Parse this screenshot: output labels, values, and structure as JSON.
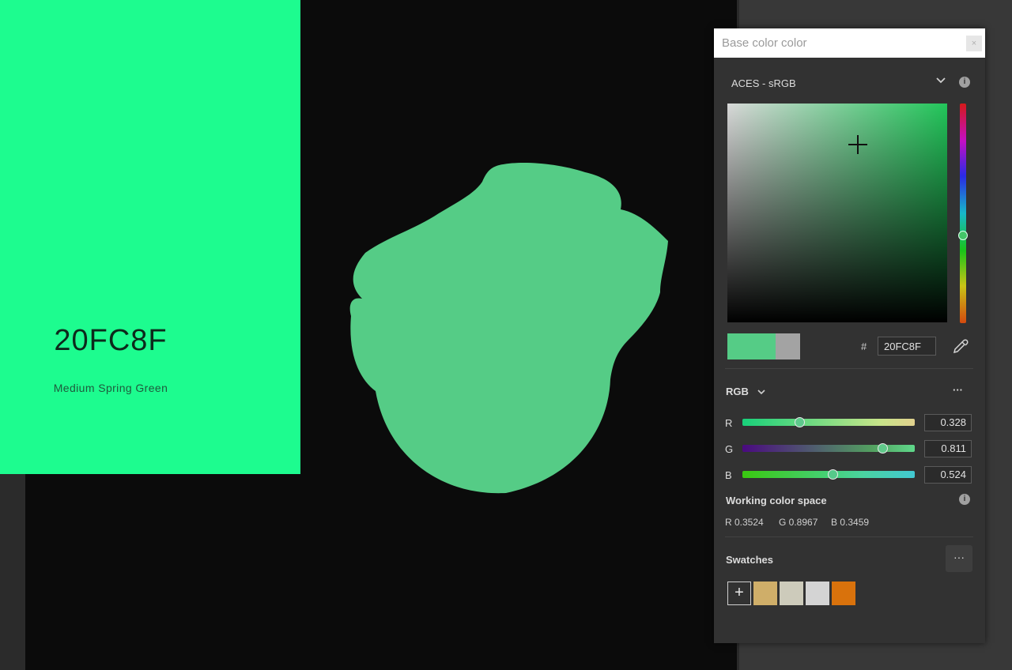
{
  "card": {
    "hex": "20FC8F",
    "name": "Medium Spring Green",
    "color": "#1dfc8f"
  },
  "object_color": "#55cc86",
  "panel": {
    "title": "Base color color",
    "close_label": "×",
    "colorspace": "ACES - sRGB",
    "hex_prefix": "#",
    "hex_value": "20FC8F",
    "mode": "RGB",
    "more_label": "···",
    "channels": [
      {
        "label": "R",
        "value": "0.328",
        "level": 0.328
      },
      {
        "label": "G",
        "value": "0.811",
        "level": 0.811
      },
      {
        "label": "B",
        "value": "0.524",
        "level": 0.524
      }
    ],
    "working_space": {
      "title": "Working color space",
      "r": "R 0.3524",
      "g": "G 0.8967",
      "b": "B 0.3459"
    },
    "swatches": {
      "title": "Swatches",
      "add_label": "+",
      "colors": [
        "#cfae69",
        "#cdcbbb",
        "#d4d4d4",
        "#d9720c"
      ]
    },
    "new_color": "#55cc86",
    "old_color": "#a3a3a3"
  }
}
